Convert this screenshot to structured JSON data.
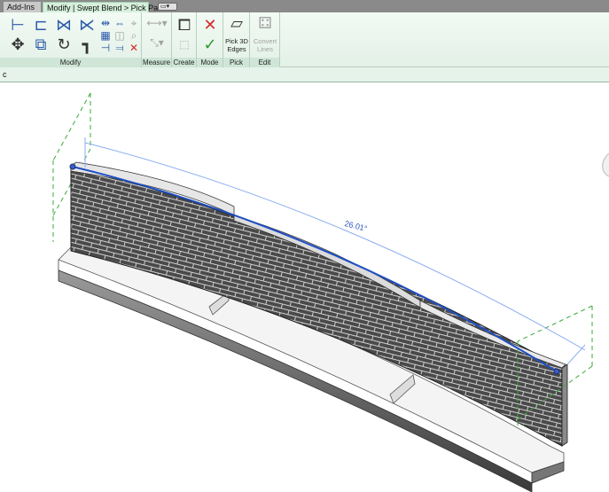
{
  "tabs": {
    "addins": "Add-Ins",
    "context": "Modify | Swept Blend > Pick Path",
    "extra": "▭▾"
  },
  "ribbon": {
    "panels": {
      "modify": "Modify",
      "measure": "Measure",
      "create": "Create",
      "mode": "Mode",
      "pick": "Pick",
      "edit": "Edit"
    },
    "pick_3d_edges": {
      "line1": "Pick 3D",
      "line2": "Edges"
    },
    "convert_lines": {
      "line1": "Convert",
      "line2": "Lines"
    }
  },
  "options_bar": {
    "text": "c"
  },
  "viewport": {
    "dimension_label": "26.01°",
    "colors": {
      "path": "#1f4fc4",
      "dimension": "#8aaef0",
      "reference": "#3aa83a",
      "brick": "#4a4a4a",
      "mortar": "#cfcfcf"
    }
  }
}
